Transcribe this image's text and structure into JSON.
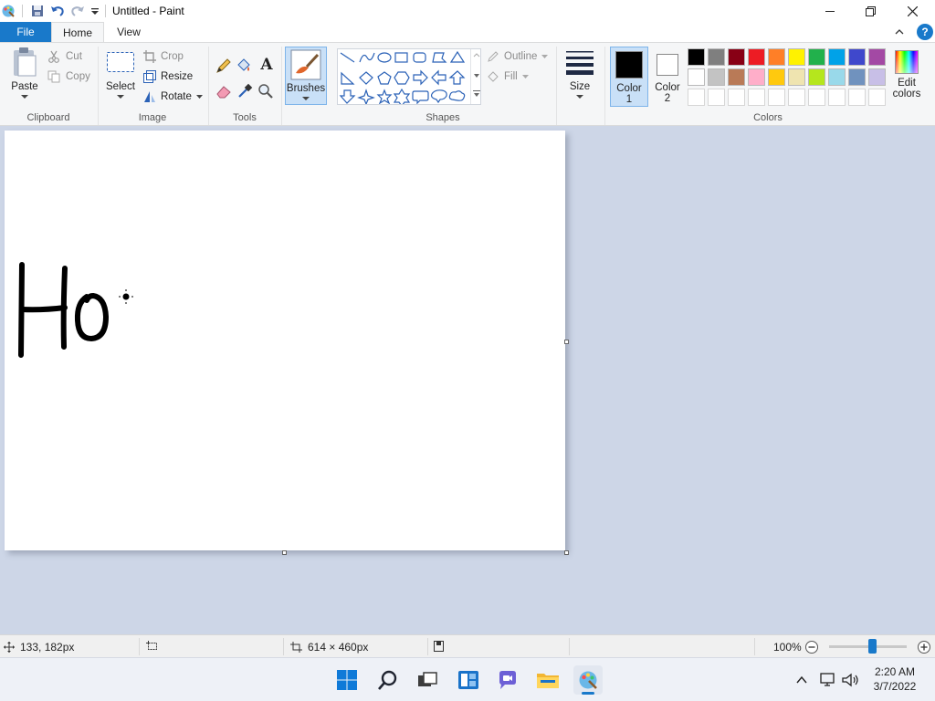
{
  "window": {
    "title": "Untitled - Paint"
  },
  "tabs": {
    "file": "File",
    "home": "Home",
    "view": "View"
  },
  "clipboard": {
    "paste": "Paste",
    "cut": "Cut",
    "copy": "Copy",
    "group": "Clipboard"
  },
  "image": {
    "select": "Select",
    "crop": "Crop",
    "resize": "Resize",
    "rotate": "Rotate",
    "group": "Image"
  },
  "tools": {
    "group": "Tools"
  },
  "brushes": {
    "label": "Brushes"
  },
  "shapes": {
    "outline": "Outline",
    "fill": "Fill",
    "group": "Shapes"
  },
  "size": {
    "label": "Size"
  },
  "colors": {
    "color1_line1": "Color",
    "color1_line2": "1",
    "color2_line1": "Color",
    "color2_line2": "2",
    "edit_line1": "Edit",
    "edit_line2": "colors",
    "group": "Colors",
    "palette_row1": [
      "#000000",
      "#7f7f7f",
      "#880015",
      "#ed1c24",
      "#ff7f27",
      "#fff200",
      "#22b14c",
      "#00a2e8",
      "#3f48cc",
      "#a349a4"
    ],
    "palette_row2": [
      "#ffffff",
      "#c3c3c3",
      "#b97a57",
      "#ffaec9",
      "#ffc90e",
      "#efe4b0",
      "#b5e61d",
      "#99d9ea",
      "#7092be",
      "#c8bfe7"
    ],
    "selected_color1": "#000000",
    "selected_color2": "#ffffff"
  },
  "status": {
    "cursor_pos": "133, 182px",
    "canvas_size": "614 × 460px",
    "zoom": "100%",
    "zoom_fraction": 0.55
  },
  "taskbar": {
    "time": "2:20 AM",
    "date": "3/7/2022"
  },
  "accent": "#1979ca"
}
